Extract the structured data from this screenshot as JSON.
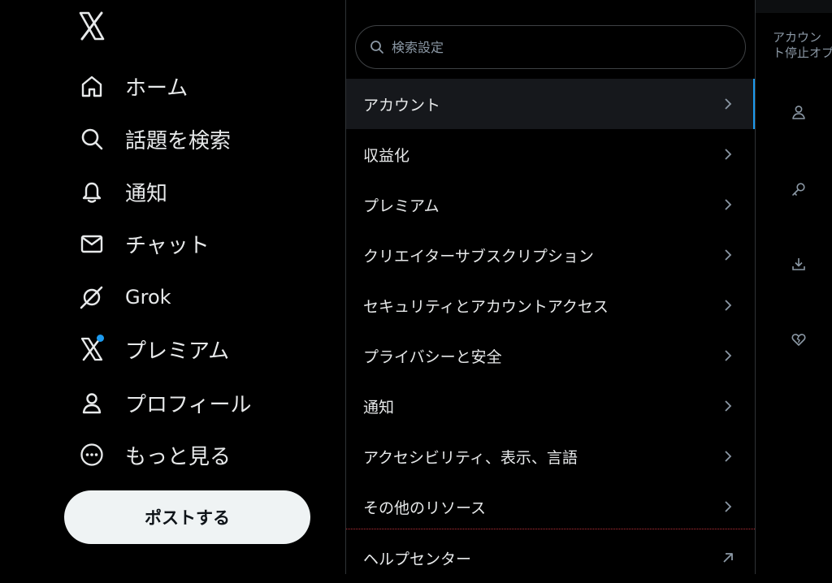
{
  "sidebar": {
    "logo": "x-logo-icon",
    "items": [
      {
        "label": "ホーム",
        "icon": "home-icon"
      },
      {
        "label": "話題を検索",
        "icon": "search-icon"
      },
      {
        "label": "通知",
        "icon": "bell-icon"
      },
      {
        "label": "チャット",
        "icon": "mail-icon"
      },
      {
        "label": "Grok",
        "icon": "grok-icon"
      },
      {
        "label": "プレミアム",
        "icon": "x-premium-icon"
      },
      {
        "label": "プロフィール",
        "icon": "person-icon"
      },
      {
        "label": "もっと見る",
        "icon": "more-circle-icon"
      }
    ],
    "post_button": "ポストする"
  },
  "settings": {
    "search_placeholder": "検索設定",
    "items": [
      {
        "label": "アカウント",
        "active": true
      },
      {
        "label": "収益化"
      },
      {
        "label": "プレミアム"
      },
      {
        "label": "クリエイターサブスクリプション"
      },
      {
        "label": "セキュリティとアカウントアクセス"
      },
      {
        "label": "プライバシーと安全"
      },
      {
        "label": "通知"
      },
      {
        "label": "アクセシビリティ、表示、言語"
      },
      {
        "label": "その他のリソース"
      }
    ],
    "help_center": "ヘルプセンター"
  },
  "detail": {
    "description_line1": "アカウン",
    "description_line2": "ト停止オプ",
    "icons": [
      "person-icon",
      "key-icon",
      "download-icon",
      "broken-heart-icon"
    ]
  },
  "colors": {
    "accent": "#1d9bf0",
    "background": "#000000",
    "text": "#e7e9ea",
    "secondary_text": "#8b98a5"
  }
}
